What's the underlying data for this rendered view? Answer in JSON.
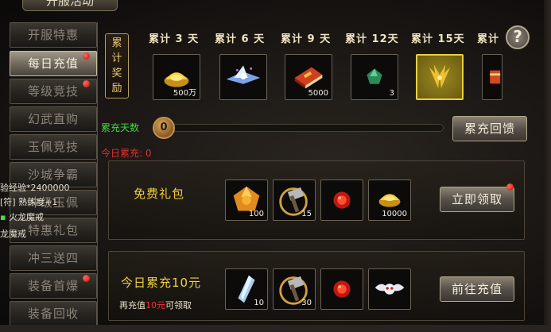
{
  "window": {
    "title": "开服活动"
  },
  "sidebar": {
    "items": [
      {
        "label": "开服特惠",
        "active": false,
        "dot": false
      },
      {
        "label": "每日充值",
        "active": true,
        "dot": true
      },
      {
        "label": "等级竞技",
        "active": false,
        "dot": true
      },
      {
        "label": "幻武直购",
        "active": false,
        "dot": false
      },
      {
        "label": "玉佩竞技",
        "active": false,
        "dot": false
      },
      {
        "label": "沙城争霸",
        "active": false,
        "dot": false
      },
      {
        "label": "冲级玉佩",
        "active": false,
        "dot": false
      },
      {
        "label": "特惠礼包",
        "active": false,
        "dot": false
      },
      {
        "label": "冲三送四",
        "active": false,
        "dot": false
      },
      {
        "label": "装备首爆",
        "active": false,
        "dot": true
      },
      {
        "label": "装备回收",
        "active": false,
        "dot": false
      }
    ]
  },
  "chat": {
    "line1": "验经验*2400000",
    "line2": "[符] 熟练度+1",
    "line3": "火龙魔戒",
    "line4": "龙魔戒"
  },
  "cumulative": {
    "label": "累计奖励",
    "days": [
      {
        "label": "累计 3 天",
        "item": "gold-ingot",
        "count": "500万"
      },
      {
        "label": "累计 6 天",
        "item": "crystal-shards",
        "count": ""
      },
      {
        "label": "累计 9 天",
        "item": "red-book",
        "count": "5000"
      },
      {
        "label": "累计 12天",
        "item": "green-gem",
        "count": "3"
      },
      {
        "label": "累计 15天",
        "item": "golden-wings",
        "count": ""
      },
      {
        "label": "累计",
        "item": "scroll",
        "count": ""
      }
    ]
  },
  "progress": {
    "label": "累充天数",
    "value": "0",
    "fraction": 0
  },
  "buttons": {
    "feedback": "累充回馈",
    "claim": "立即领取",
    "recharge": "前往充值",
    "help": "?"
  },
  "today_total": {
    "label": "今日累充:",
    "value": "0"
  },
  "packs": [
    {
      "title": "免费礼包",
      "sub_prefix": "",
      "sub_amount": "",
      "sub_suffix": "",
      "items": [
        {
          "icon": "orange-gem-icon",
          "count": "100"
        },
        {
          "icon": "hammer-icon",
          "count": "15"
        },
        {
          "icon": "red-orb-icon",
          "count": ""
        },
        {
          "icon": "gold-ingot-icon",
          "count": "10000"
        }
      ]
    },
    {
      "title": "今日累充10元",
      "sub_prefix": "再充值",
      "sub_amount": "10元",
      "sub_suffix": "可领取",
      "items": [
        {
          "icon": "blue-crystal-icon",
          "count": "10"
        },
        {
          "icon": "hammer-icon",
          "count": "30"
        },
        {
          "icon": "red-orb-icon",
          "count": ""
        },
        {
          "icon": "winged-skull-icon",
          "count": ""
        }
      ]
    }
  ],
  "colors": {
    "accent_gold": "#f0d040",
    "green": "#40d840",
    "red": "#e03030"
  }
}
